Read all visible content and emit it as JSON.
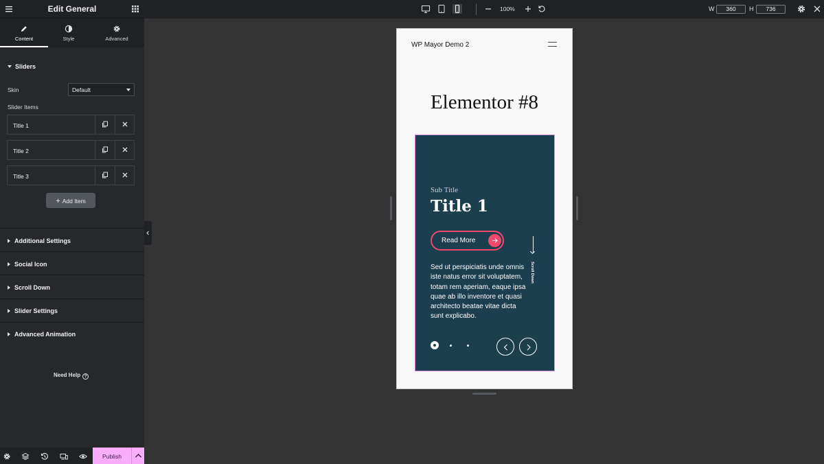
{
  "panel": {
    "title": "Edit General",
    "tabs": [
      {
        "label": "Content",
        "icon": "pencil-icon"
      },
      {
        "label": "Style",
        "icon": "contrast-icon"
      },
      {
        "label": "Advanced",
        "icon": "gear-icon"
      }
    ],
    "active_tab": "Content",
    "section_sliders": "Sliders",
    "skin_label": "Skin",
    "skin_value": "Default",
    "slider_items_label": "Slider Items",
    "slider_items": [
      {
        "title": "Title 1"
      },
      {
        "title": "Title 2"
      },
      {
        "title": "Title 3"
      }
    ],
    "add_item_label": "Add Item",
    "collapsed_sections": [
      "Additional Settings",
      "Social Icon",
      "Scroll Down",
      "Slider Settings",
      "Advanced Animation"
    ],
    "help_label": "Need Help",
    "publish_label": "Publish"
  },
  "topbar": {
    "zoom": "100%",
    "width_label": "W",
    "width_value": "360",
    "height_label": "H",
    "height_value": "736",
    "active_device": "mobile"
  },
  "preview": {
    "site_title": "WP Mayor Demo 2",
    "page_heading": "Elementor #8",
    "slide": {
      "sub_title": "Sub Title",
      "title": "Title 1",
      "button_label": "Read More",
      "text": "Sed ut perspiciatis unde omnis iste natus error sit voluptatem, totam rem aperiam, eaque ipsa quae ab illo inventore et quasi architecto beatae vitae dicta sunt explicabo.",
      "scroll_down_label": "Scroll Down",
      "dots_count": 3,
      "active_dot": 1
    }
  },
  "colors": {
    "slide_bg": "#1b3f4e",
    "accent_pink": "#f2496b",
    "publish_bg": "#f8aefc",
    "panel_bg": "#26282b",
    "canvas_bg": "#333333"
  }
}
